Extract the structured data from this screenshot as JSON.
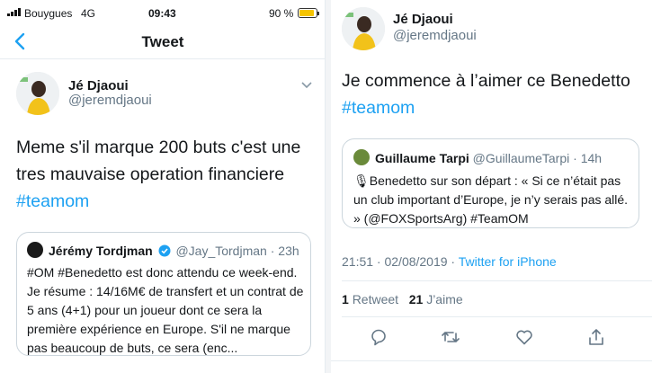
{
  "status_bar": {
    "carrier": "Bouygues",
    "network": "4G",
    "time": "09:43",
    "battery": "90 %",
    "battery_level": 0.9
  },
  "nav": {
    "title": "Tweet"
  },
  "left_tweet": {
    "author_name": "Jé Djaoui",
    "author_handle": "@jeremdjaoui",
    "text": "Meme s'il marque 200 buts c'est une tres mauvaise operation financiere",
    "hashtag": "#teamom",
    "quote": {
      "name": "Jérémy Tordjman",
      "handle": "@Jay_Tordjman",
      "time": "23h",
      "text": "#OM #Benedetto est donc attendu ce week-end. Je résume : 14/16M€ de transfert et un contrat de 5 ans (4+1) pour un joueur dont ce sera la première expérience en Europe. S'il ne marque pas beaucoup de buts, ce sera (enc..."
    }
  },
  "right_tweet": {
    "author_name": "Jé Djaoui",
    "author_handle": "@jeremdjaoui",
    "text": "Je commence à l’aimer ce Benedetto",
    "hashtag": "#teamom",
    "quote": {
      "name": "Guillaume Tarpi",
      "handle": "@GuillaumeTarpi",
      "time": "14h",
      "text": "Benedetto sur son départ : « Si ce n’était pas un club important d’Europe, je n’y serais pas allé. » (@FOXSportsArg) #TeamOM"
    },
    "timestamp": "21:51 · 02/08/2019 · ",
    "source": "Twitter for iPhone",
    "retweets_count": "1",
    "retweets_label": "Retweet",
    "likes_count": "21",
    "likes_label": "J’aime",
    "actions": [
      "reply-icon",
      "retweet-icon",
      "like-icon",
      "share-icon"
    ]
  },
  "colors": {
    "accent": "#1da1f2",
    "text": "#14171a",
    "muted": "#657786",
    "border": "#ccd6dd"
  }
}
